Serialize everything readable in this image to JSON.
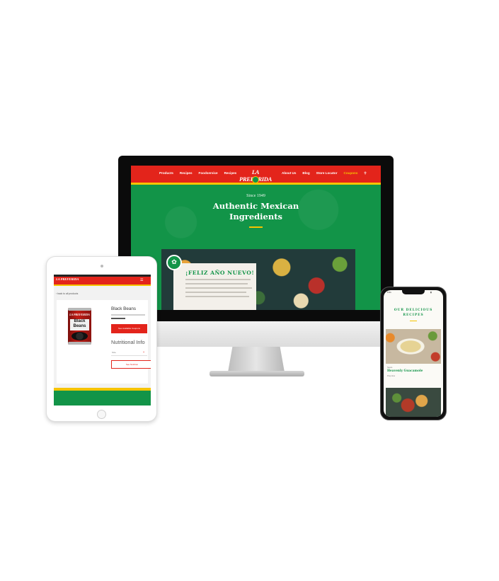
{
  "desktop": {
    "nav_left": [
      "Products",
      "Recipes",
      "Foodservice",
      "Recipes"
    ],
    "logo": "LA PREFERIDA",
    "nav_right": [
      "About Us",
      "Blog",
      "Store Locator",
      "Coupons"
    ],
    "nav_highlight": "Coupons",
    "search_icon": "search-icon",
    "hero": {
      "since": "Since 1949",
      "title": "Authentic Mexican Ingredients"
    },
    "card": {
      "title": "¡FELIZ AÑO NUEVO!",
      "icon": "leaf-icon"
    },
    "colors": {
      "nav_red": "#e3241b",
      "accent_yellow": "#f5c400",
      "brand_green": "#129448"
    }
  },
  "tablet": {
    "logo": "LA PREFERIDA",
    "back_link": "‹ back to all products",
    "can": {
      "brand": "LA PREFERIDA",
      "label": "Black Beans"
    },
    "product_title": "Black Beans",
    "coupon_button": "See Available Coupons",
    "nutrition_title": "Nutritional Info",
    "select_value": "Size",
    "nutrition_button": "See Nutrition",
    "menu_icon": "menu-icon"
  },
  "phone": {
    "time": "9:41",
    "heading": "OUR DELICIOUS RECIPES",
    "recipe_title": "Heavenly Guacamole",
    "recipe_category": "Sauce",
    "recipe_meta": "Prep time"
  }
}
